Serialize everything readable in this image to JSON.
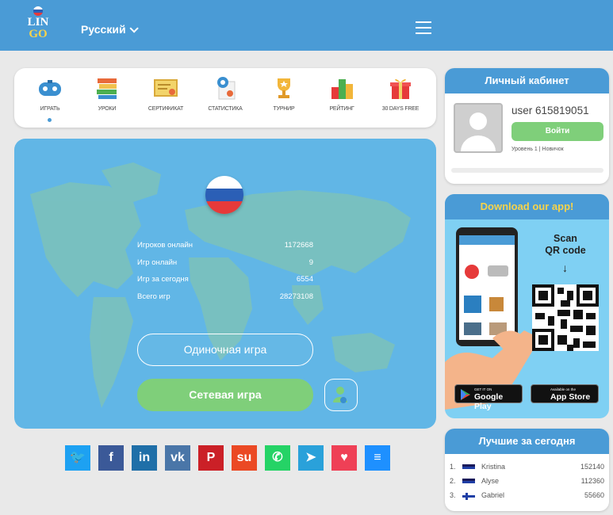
{
  "header": {
    "logo_line1": "LIN",
    "logo_line2": "GO",
    "language": "Русский"
  },
  "menu": {
    "items": [
      {
        "label": "ИГРАТЬ",
        "icon": "gamepad-icon"
      },
      {
        "label": "УРОКИ",
        "icon": "books-icon"
      },
      {
        "label": "СЕРТИФИКАТ",
        "icon": "certificate-icon"
      },
      {
        "label": "СТАТИСТИКА",
        "icon": "statistics-icon"
      },
      {
        "label": "ТУРНИР",
        "icon": "trophy-icon"
      },
      {
        "label": "РЕЙТИНГ",
        "icon": "podium-icon"
      },
      {
        "label": "30 DAYS FREE",
        "icon": "gift-icon"
      }
    ]
  },
  "stats": [
    {
      "label": "Игроков онлайн",
      "value": "1172668"
    },
    {
      "label": "Игр онлайн",
      "value": "9"
    },
    {
      "label": "Игр за сегодня",
      "value": "6554"
    },
    {
      "label": "Всего игр",
      "value": "28273108"
    }
  ],
  "buttons": {
    "single": "Одиночная игра",
    "network": "Сетевая игра"
  },
  "social": [
    {
      "icon": "twitter-icon",
      "glyph": "🐦",
      "color": "#1da1f2"
    },
    {
      "icon": "facebook-icon",
      "glyph": "f",
      "color": "#3b5998"
    },
    {
      "icon": "linkedin-icon",
      "glyph": "in",
      "color": "#1f6fa8"
    },
    {
      "icon": "vk-icon",
      "glyph": "vk",
      "color": "#4a76a8"
    },
    {
      "icon": "pinterest-icon",
      "glyph": "P",
      "color": "#cb2027"
    },
    {
      "icon": "stumbleupon-icon",
      "glyph": "su",
      "color": "#eb4924"
    },
    {
      "icon": "whatsapp-icon",
      "glyph": "✆",
      "color": "#25d366"
    },
    {
      "icon": "telegram-icon",
      "glyph": "➤",
      "color": "#2aa1da"
    },
    {
      "icon": "pocket-icon",
      "glyph": "♥",
      "color": "#ef4056"
    },
    {
      "icon": "message-icon",
      "glyph": "≡",
      "color": "#1e90ff"
    }
  ],
  "account": {
    "title": "Личный кабинет",
    "username": "user 615819051",
    "login": "Войти",
    "level": "Уровень 1 | Новичок"
  },
  "app": {
    "title": "Download our app!",
    "scan_line1": "Scan",
    "scan_line2": "QR code",
    "google_small": "GET IT ON",
    "google_big": "Google Play",
    "apple_small": "Available on the",
    "apple_big": "App Store"
  },
  "leaders": {
    "title": "Лучшие за сегодня",
    "rows": [
      {
        "rank": "1.",
        "name": "Kristina",
        "score": "152140"
      },
      {
        "rank": "2.",
        "name": "Alyse",
        "score": "112360"
      },
      {
        "rank": "3.",
        "name": "Gabriel",
        "score": "55660"
      }
    ]
  }
}
